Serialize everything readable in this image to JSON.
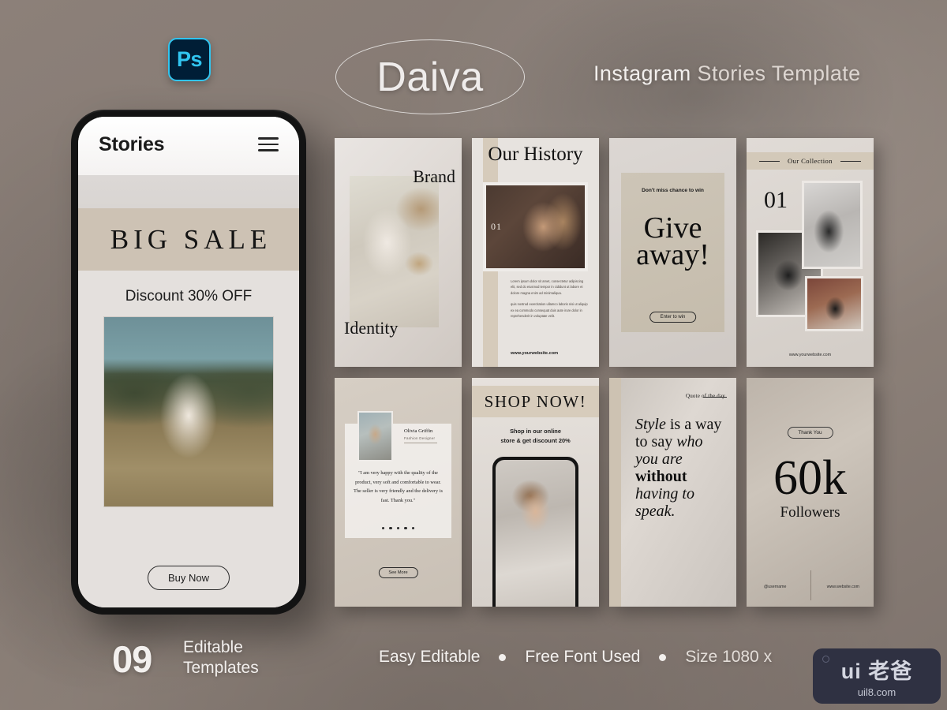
{
  "header": {
    "ps_badge": "Ps",
    "brand": "Daiva",
    "title_strong": "Instagram",
    "title_rest": " Stories Template"
  },
  "phone": {
    "title": "Stories",
    "menu_icon": "hamburger-icon",
    "banner": "BIG SALE",
    "discount": "Discount 30% OFF",
    "cta": "Buy Now"
  },
  "cards": {
    "brand_identity": {
      "top_text": "Brand",
      "bottom_text": "Identity"
    },
    "our_history": {
      "title": "Our History",
      "number": "01",
      "paragraph1": "Lorem ipsum dolor sit amet, consectetur adipiscing elit, sed do eiusmod tempor in cididunt ut labore et dolore magna enim ad minimaliqua.",
      "paragraph2": "quis nostrud exercitation ullamco laboris nisi ut aliquip ex ea commodo consequat duis aute irure dolor in reprehenderit in voluptate velit.",
      "website": "www.yourwebsite.com"
    },
    "giveaway": {
      "kicker": "Don't miss chance to win",
      "headline_line1": "Give",
      "headline_line2": "away!",
      "cta": "Enter to win"
    },
    "our_collection": {
      "title": "Our Collection",
      "number": "01",
      "website": "www.yourwebsite.com"
    },
    "testimonial": {
      "name": "Olivia Griffin",
      "role": "Fashion Designer",
      "quote": "\"I am very happy with the quality of the product, very soft and comfortable to wear. The seller is very friendly and the delivery is fast. Thank you.\"",
      "dots": 5,
      "cta": "See More"
    },
    "shop_now": {
      "title": "SHOP NOW!",
      "subtitle_line1": "Shop in our online",
      "subtitle_line2": "store & get discount 20%"
    },
    "quote_of_day": {
      "label": "Quote of the day",
      "segments": [
        {
          "text": "Style",
          "style": "italic"
        },
        {
          "text": " is a way to say ",
          "style": "normal"
        },
        {
          "text": "who you are",
          "style": "italic"
        },
        {
          "text": " ",
          "style": "normal"
        },
        {
          "text": "without",
          "style": "bold"
        },
        {
          "text": " ",
          "style": "normal"
        },
        {
          "text": "having to speak.",
          "style": "italic"
        }
      ]
    },
    "followers": {
      "badge": "Thank You",
      "count": "60k",
      "label": "Followers",
      "username": "@username",
      "website": "www.website.com"
    }
  },
  "footer": {
    "count": "09",
    "count_label_line1": "Editable",
    "count_label_line2": "Templates",
    "feature1": "Easy Editable",
    "feature2": "Free Font Used",
    "feature3": "Size 1080 x"
  },
  "watermark": {
    "line1": "ui 老爸",
    "line2": "uil8.com"
  },
  "colors": {
    "background": "#857a73",
    "ps_accent": "#31c5f0",
    "ps_bg": "#001e36",
    "band": "#cdc2b4",
    "watermark_bg": "#2f3142"
  }
}
